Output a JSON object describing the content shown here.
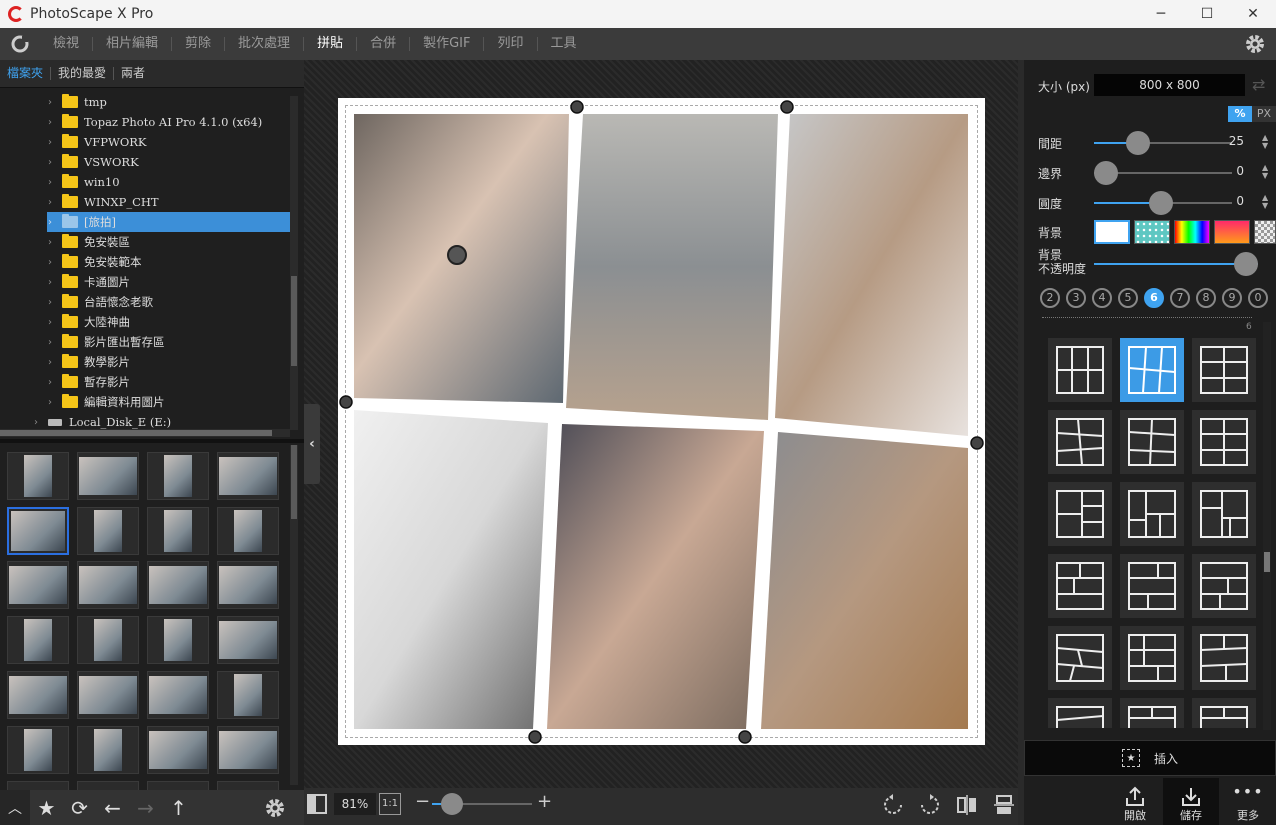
{
  "window": {
    "title": "PhotoScape X Pro",
    "minimize": "─",
    "maximize": "☐",
    "close": "✕"
  },
  "menu": {
    "items": [
      "檢視",
      "相片編輯",
      "剪除",
      "批次處理",
      "拼貼",
      "合併",
      "製作GIF",
      "列印",
      "工具"
    ],
    "active": "拼貼"
  },
  "left_tabs": [
    "檔案夾",
    "我的最愛",
    "兩者"
  ],
  "tree": [
    "tmp",
    "Topaz Photo AI Pro 4.1.0 (x64)",
    "VFPWORK",
    "VSWORK",
    "win10",
    "WINXP_CHT",
    "[旅拍]",
    "免安裝區",
    "免安裝範本",
    "卡通圖片",
    "台語懷念老歌",
    "大陸神曲",
    "影片匯出暫存區",
    "教學影片",
    "暫存影片",
    "編輯資料用圖片"
  ],
  "tree_selected": "[旅拍]",
  "tree_disk": "Local_Disk_E (E:)",
  "zoom": {
    "value": "81%",
    "one_to_one": "1:1"
  },
  "right": {
    "size_label": "大小 (px)",
    "size_value": "800 x 800",
    "unit_percent": "%",
    "unit_px": "PX",
    "spacing_label": "間距",
    "spacing_value": "25",
    "spacing_fraction": 0.28,
    "border_label": "邊界",
    "border_value": "0",
    "border_fraction": 0.0,
    "roundness_label": "圓度",
    "roundness_value": "0",
    "roundness_fraction": 0.48,
    "background_label": "背景",
    "opacity_label_1": "背景",
    "opacity_label_2": "不透明度",
    "opacity_fraction": 1.0,
    "photo_counts": [
      "2",
      "3",
      "4",
      "5",
      "6",
      "7",
      "8",
      "9",
      "0"
    ],
    "photo_count_active": "6",
    "page_number": "6",
    "insert_label": "插入",
    "open_label": "開啟",
    "save_label": "儲存",
    "more_label": "更多"
  },
  "colors": {
    "accent": "#3fa3f0",
    "folder": "#f5c518",
    "selection": "#3c8fd8"
  }
}
